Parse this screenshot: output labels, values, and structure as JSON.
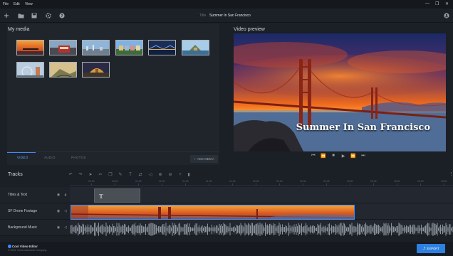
{
  "menu": {
    "items": [
      "File",
      "Edit",
      "View"
    ]
  },
  "window_controls": {
    "minimize": "—",
    "restore": "❐",
    "close": "✕"
  },
  "toolbar": {
    "title_label": "Title",
    "title_value": "Summer In San Francisco",
    "icons": [
      "add-icon",
      "folder-icon",
      "save-icon",
      "settings-icon",
      "help-icon",
      "user-icon"
    ]
  },
  "media": {
    "title": "My media",
    "thumbnails": [
      {
        "name": "sunset-pier"
      },
      {
        "name": "cable-car"
      },
      {
        "name": "city-skyline"
      },
      {
        "name": "painted-ladies"
      },
      {
        "name": "bay-bridge-night"
      },
      {
        "name": "coastal-cliffs"
      },
      {
        "name": "ferris-wheel"
      },
      {
        "name": "hills-road"
      },
      {
        "name": "palace-of-fine-arts"
      }
    ],
    "tabs": [
      "VIDEO",
      "AUDIO",
      "PHOTOS"
    ],
    "active_tab": 0,
    "add_button": "ADD MEDIA"
  },
  "preview": {
    "title": "Video preview",
    "overlay_text": "Summer In San Francisco",
    "controls": [
      "skip-back-icon",
      "rewind-icon",
      "stop-icon",
      "play-icon",
      "fast-forward-icon",
      "skip-forward-icon"
    ]
  },
  "tracks": {
    "title": "Tracks",
    "ruler": [
      "00:15",
      "00:30",
      "00:45",
      "01:00",
      "01:15",
      "01:30",
      "01:45",
      "02:00",
      "02:15",
      "02:30",
      "02:45",
      "03:00",
      "03:15",
      "03:30",
      "03:45",
      "04:00"
    ],
    "rows": [
      {
        "name": "Titles & Text",
        "locked": true
      },
      {
        "name": "SF Drone Footage",
        "locked": false
      },
      {
        "name": "Background Music",
        "locked": false
      }
    ]
  },
  "footer": {
    "brand": "Cool Video Editor",
    "copyright": "© 2021. Some Awesome Company",
    "export_button": "EXPORT"
  },
  "colors": {
    "accent": "#3d8bff",
    "export": "#2d7fe0",
    "background": "#1b1f26",
    "panel": "#20252c"
  }
}
